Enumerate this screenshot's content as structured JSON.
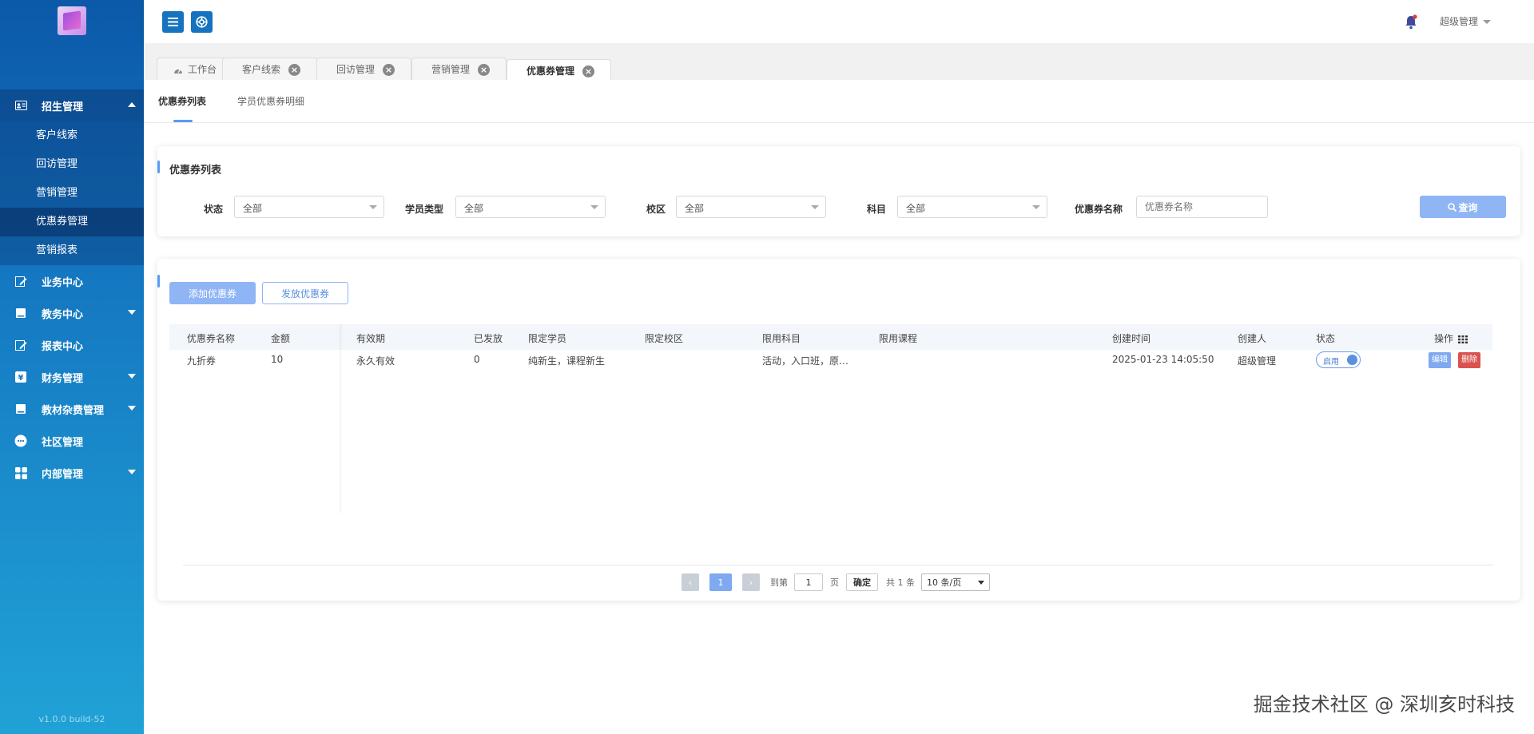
{
  "sidebar": {
    "version": "v1.0.0 build-52",
    "groups": [
      {
        "label": "招生管理",
        "icon": "id-card-icon"
      },
      {
        "label": "业务中心",
        "icon": "edit-icon"
      },
      {
        "label": "教务中心",
        "icon": "book-icon"
      },
      {
        "label": "报表中心",
        "icon": "report-icon"
      },
      {
        "label": "财务管理",
        "icon": "finance-icon"
      },
      {
        "label": "教材杂费管理",
        "icon": "book-open-icon"
      },
      {
        "label": "社区管理",
        "icon": "chat-icon"
      },
      {
        "label": "内部管理",
        "icon": "grid-icon"
      }
    ],
    "sub_items": [
      "客户线索",
      "回访管理",
      "营销管理",
      "优惠券管理",
      "营销报表"
    ],
    "active_sub": "优惠券管理"
  },
  "header": {
    "user": "超级管理"
  },
  "tabs": [
    {
      "label": "工作台"
    },
    {
      "label": "客户线索"
    },
    {
      "label": "回访管理"
    },
    {
      "label": "营销管理"
    },
    {
      "label": "优惠券管理"
    }
  ],
  "subtabs": [
    "优惠券列表",
    "学员优惠券明细"
  ],
  "filter": {
    "title": "优惠券列表",
    "status_label": "状态",
    "status_value": "全部",
    "student_type_label": "学员类型",
    "student_type_value": "全部",
    "campus_label": "校区",
    "campus_value": "全部",
    "subject_label": "科目",
    "subject_value": "全部",
    "name_label": "优惠券名称",
    "name_placeholder": "优惠券名称",
    "query_label": "查询"
  },
  "actions": {
    "add_label": "添加优惠券",
    "issue_label": "发放优惠券"
  },
  "table": {
    "headers": [
      "优惠券名称",
      "金额",
      "有效期",
      "已发放",
      "限定学员",
      "限定校区",
      "限用科目",
      "限用课程",
      "创建时间",
      "创建人",
      "状态",
      "操作"
    ],
    "rows": [
      {
        "name": "九折券",
        "amount": "10",
        "validity": "永久有效",
        "issued": "0",
        "students": "纯新生，课程新生",
        "campus": "",
        "subjects": "活动，入口班，原…",
        "courses": "",
        "created_at": "2025-01-23 14:05:50",
        "creator": "超级管理",
        "status": "启用",
        "edit": "编辑",
        "delete": "删除"
      }
    ]
  },
  "pager": {
    "current": "1",
    "goto_prefix": "到第",
    "goto_value": "1",
    "page_suffix": "页",
    "confirm": "确定",
    "total": "共 1 条",
    "size": "10 条/页"
  },
  "watermark": "掘金技术社区 @ 深圳亥时科技",
  "colors": {
    "sidebar_top": "#0b59a8",
    "sidebar_bottom": "#20a2d6",
    "accent": "#8fb5f5",
    "delete": "#d9534f"
  }
}
